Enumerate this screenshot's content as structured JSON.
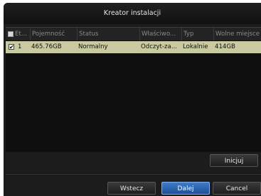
{
  "window": {
    "title": "Kreator instalacji"
  },
  "table": {
    "columns": [
      "Et...",
      "Pojemność",
      "Status",
      "Właściwo...",
      "Typ",
      "Wolne miejsce"
    ],
    "rows": [
      {
        "checked": true,
        "label": "1",
        "capacity": "465.76GB",
        "status": "Normalny",
        "property": "Odczyt-za...",
        "type": "Lokalnie",
        "free": "414GB"
      }
    ]
  },
  "buttons": {
    "init": "Inicjuj",
    "back": "Wstecz",
    "next": "Dalej",
    "cancel": "Cancel"
  },
  "icons": {
    "checkbox_checked": "✔"
  },
  "colors": {
    "row_selected": "#c9c9a2",
    "button_active": "#2e64ae"
  }
}
